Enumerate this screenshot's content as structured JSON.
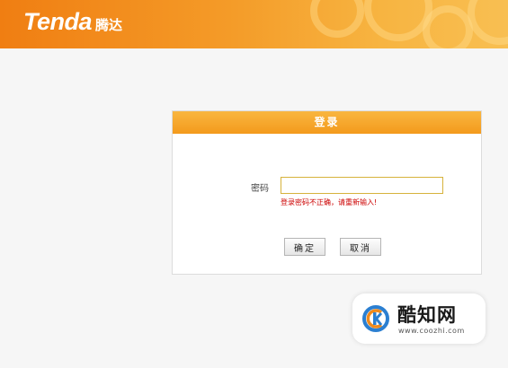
{
  "header": {
    "logo_text": "Tenda",
    "logo_cn": "腾达",
    "bg_color": "#f39a1c"
  },
  "login": {
    "title": "登录",
    "password_label": "密码",
    "password_value": "",
    "error_message": "登录密码不正确，请重新输入!",
    "ok_label": "确定",
    "cancel_label": "取消",
    "error_color": "#cc0000"
  },
  "watermark": {
    "title": "酷知网",
    "url": "www.coozhi.com",
    "icon": "coozhi-logo-icon"
  }
}
